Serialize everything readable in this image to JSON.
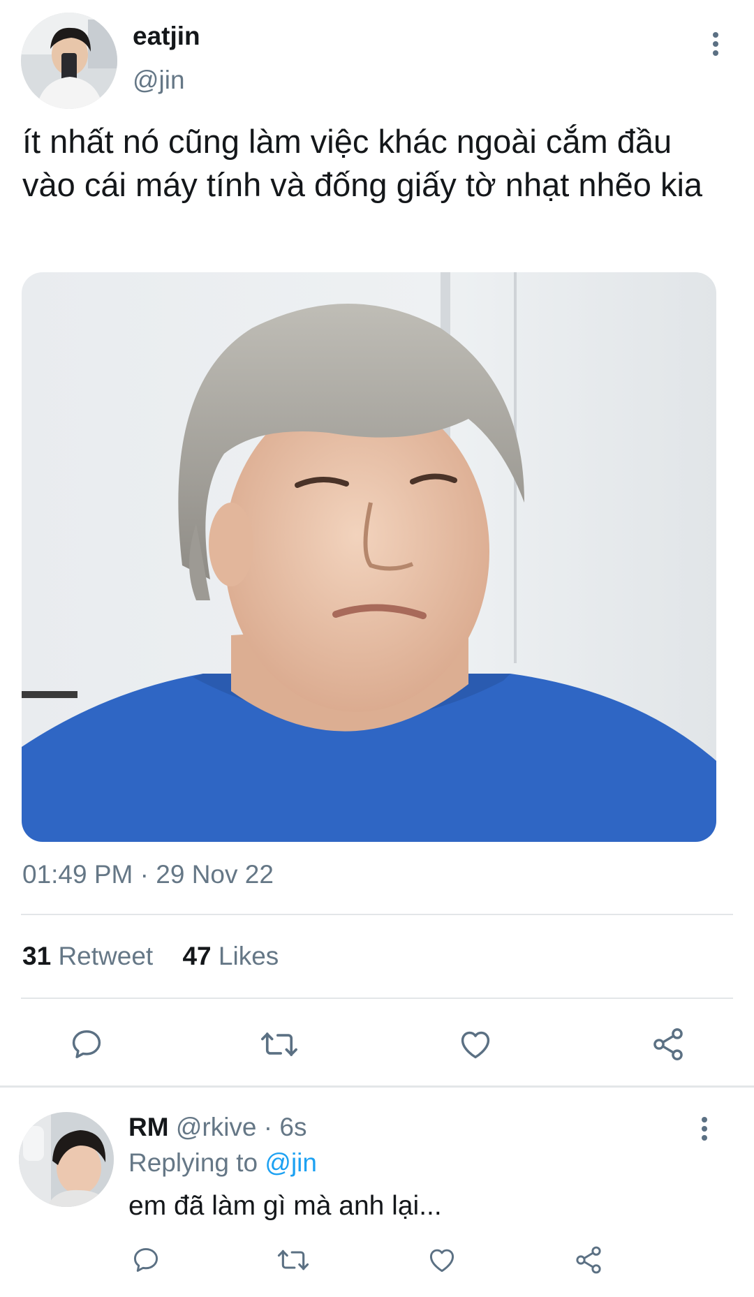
{
  "tweet": {
    "display_name": "eatjin",
    "handle": "@jin",
    "text": "ít nhất nó cũng làm việc khác ngoài cắm đầu vào cái máy tính và đống giấy tờ nhạt nhẽo kia",
    "time": "01:49 PM",
    "separator": "·",
    "date": "29 Nov 22",
    "stats": {
      "retweet_count": "31",
      "retweet_label": "Retweet",
      "likes_count": "47",
      "likes_label": "Likes"
    },
    "actions": [
      "reply-icon",
      "retweet-icon",
      "like-icon",
      "share-icon"
    ]
  },
  "reply": {
    "display_name": "RM",
    "handle": "@rkive",
    "separator": "·",
    "age": "6s",
    "replying_prefix": "Replying to",
    "replying_to": "@jin",
    "text": "em đã làm gì mà anh lại...",
    "actions": [
      "reply-icon",
      "retweet-icon",
      "like-icon",
      "share-icon"
    ]
  },
  "colors": {
    "text_primary": "#14171a",
    "text_secondary": "#657786",
    "accent": "#1da1f2",
    "icon": "#5b7083",
    "divider": "#e3e6e8",
    "shirt_blue": "#2f66c4"
  }
}
